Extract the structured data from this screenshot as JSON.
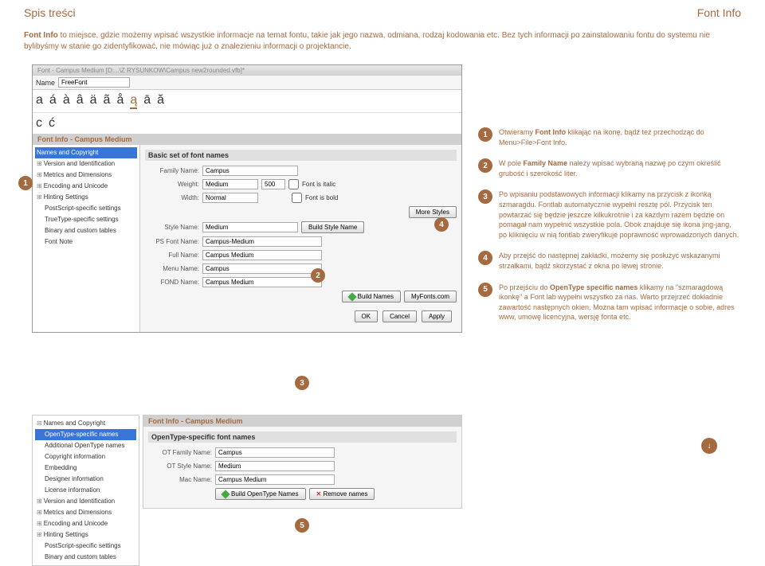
{
  "header": {
    "left": "Spis treści",
    "right": "Font Info"
  },
  "intro": {
    "t1": "Font Info",
    "t2": " to miejsce, gdzie możemy wpisać wszystkie informacje na temat fontu, takie jak jego nazwa, odmiana, rodzaj kodowania etc. Bez tych informacji po zainstalowaniu fontu do systemu nie bylibyśmy w stanie go zidentyfikować, nie mówiąc już o znalezieniu informacji o projektancie."
  },
  "app": {
    "title": "Font - Campus Medium [D:...\\Z RYSUNKOW\\Campus new2rounded.vfb]*",
    "toolbar_name": "Name",
    "toolbar_font": "FreeFont",
    "glyphs": [
      "a",
      "á",
      "à",
      "â",
      "ä",
      "ã",
      "å",
      "ą",
      "ā",
      "ă"
    ],
    "glyphs2": [
      "c",
      "ć"
    ],
    "info_title": "Font Info - Campus Medium",
    "tree1": [
      "Names and Copyright",
      "Version and Identification",
      "Metrics and Dimensions",
      "Encoding and Unicode",
      "Hinting Settings",
      "PostScript-specific settings",
      "TrueType-specific settings",
      "Binary and custom tables",
      "Font Note"
    ],
    "panel_title": "Basic set of font names",
    "family_lbl": "Family Name:",
    "family": "Campus",
    "weight_lbl": "Weight:",
    "weight": "Medium",
    "weight_num": "500",
    "width_lbl": "Width:",
    "width": "Normal",
    "italic": "Font is italic",
    "bold": "Font is bold",
    "more": "More Styles",
    "style_lbl": "Style Name:",
    "style": "Medium",
    "build_style": "Build Style Name",
    "ps_lbl": "PS Font Name:",
    "ps": "Campus-Medium",
    "full_lbl": "Full Name:",
    "full": "Campus Medium",
    "menu_lbl": "Menu Name:",
    "menu": "Campus",
    "fond_lbl": "FOND Name:",
    "fond": "Campus Medium",
    "build_names": "Build Names",
    "myfonts": "MyFonts.com",
    "ok": "OK",
    "cancel": "Cancel",
    "apply": "Apply",
    "info_title2": "Font Info - Campus Medium",
    "tree2": [
      "Names and Copyright",
      "OpenType-specific names",
      "Additional OpenType names",
      "Copyright information",
      "Embedding",
      "Designer information",
      "License information",
      "Version and Identification",
      "Metrics and Dimensions",
      "Encoding and Unicode",
      "Hinting Settings",
      "PostScript-specific settings",
      "Binary and custom tables"
    ],
    "panel2_title": "OpenType-specific font names",
    "ot_family_lbl": "OT Family Name:",
    "ot_family": "Campus",
    "ot_style_lbl": "OT Style Name:",
    "ot_style": "Medium",
    "mac_lbl": "Mac Name:",
    "mac": "Campus Medium",
    "build_ot": "Build OpenType Names",
    "remove": "Remove names"
  },
  "steps": {
    "s1a": "Otwieramy ",
    "s1b": "Font Info",
    "s1c": " klikając na ikonę, bądź też przechodząc do ",
    "s1d": "Menu>File>Font Info.",
    "s2a": "W pole ",
    "s2b": "Family Name",
    "s2c": " należy wpisać wybraną nazwę po czym określić grubość i szerokość liter.",
    "s3": "Po wpisaniu podstawowych informacji klikamy na przycisk z ikonką szmaragdu. Fontlab automatycznie wypełni resztę pól. Przycisk ten powtarzać się będzie jeszcze kilkukrotnie i za każdym razem będzie on pomagał nam wypełnić wszystkie pola. Obok znajduje się ikona jing-jang, po kliknięciu w nią fontlab zweryfikuje poprawność wprowadzonych danych.",
    "s4": "Aby przejść do następnej zakładki, możemy się posłużyć wskazanymi strzałkami, bądź skorzystać z okna po lewej stronie.",
    "s5a": "Po przejściu do ",
    "s5b": "OpenType specific names",
    "s5c": " klikamy na \"szmaragdową ikonkę\" a Font lab wypełni wszystko za nas. Warto przejrzeć dokładnie zawartość następnych okien. Można tam wpisać informacje o sobie, adres www,  umowę licencyjna, wersję fonta etc."
  }
}
